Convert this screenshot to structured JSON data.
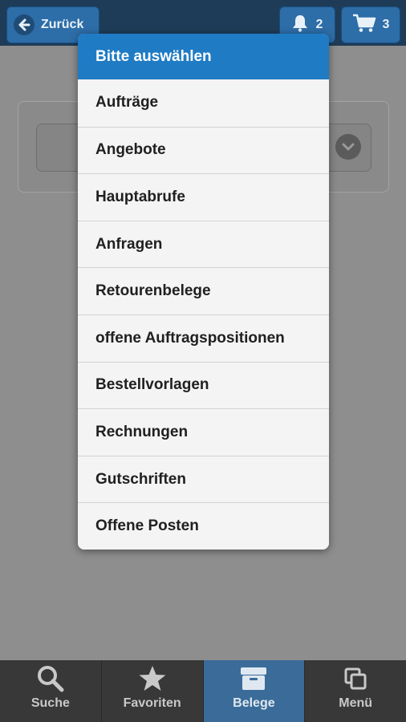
{
  "header": {
    "back_label": "Zurück",
    "notifications_count": "2",
    "cart_count": "3"
  },
  "popup": {
    "title": "Bitte auswählen",
    "items": [
      "Aufträge",
      "Angebote",
      "Hauptabrufe",
      "Anfragen",
      "Retourenbelege",
      "offene Auftragspositionen",
      "Bestellvorlagen",
      "Rechnungen",
      "Gutschriften",
      "Offene Posten"
    ]
  },
  "nav": {
    "items": [
      {
        "label": "Suche",
        "icon": "search-icon"
      },
      {
        "label": "Favoriten",
        "icon": "star-icon"
      },
      {
        "label": "Belege",
        "icon": "archive-box-icon",
        "active": true
      },
      {
        "label": "Menü",
        "icon": "windows-icon"
      }
    ]
  },
  "colors": {
    "header_bg": "#1e3c58",
    "button_blue": "#2d6da8",
    "popup_header": "#1f7bc4",
    "nav_bg": "#383838",
    "nav_active": "#3b6c99"
  }
}
